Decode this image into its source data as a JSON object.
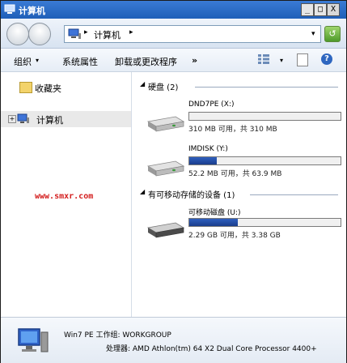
{
  "window": {
    "title": "计算机",
    "min_label": "_",
    "max_label": "□",
    "close_label": "X"
  },
  "nav": {
    "address_text": "计算机",
    "sep": "▸",
    "dropdown": "▾",
    "refresh": "↺"
  },
  "toolbar": {
    "organize": "组织",
    "organize_arrow": "▾",
    "system_properties": "系统属性",
    "uninstall": "卸载或更改程序",
    "more": "»",
    "view_arrow": "▾",
    "help": "?"
  },
  "navpane": {
    "favorites": "收藏夹",
    "computer": "计算机",
    "expand": "+",
    "watermark": "www.smxr.com"
  },
  "content": {
    "group_hdd": "硬盘 (2)",
    "group_removable": "有可移动存储的设备 (1)",
    "group_arrow": "◢",
    "drives": [
      {
        "name": "DND7PE (X:)",
        "detail": "310 MB 可用，共 310 MB",
        "usage": 0.0
      },
      {
        "name": "IMDISK (Y:)",
        "detail": "52.2 MB 可用，共 63.9 MB",
        "usage": 0.18
      },
      {
        "name": "可移动磁盘 (U:)",
        "detail": "2.29 GB 可用，共 3.38 GB",
        "usage": 0.32
      }
    ]
  },
  "details": {
    "line1": "Win7 PE  工作组: WORKGROUP",
    "line2": "处理器: AMD Athlon(tm) 64 X2 Dual Core Processor 4400+"
  },
  "colors": {
    "title_bar": "#2c6cc8",
    "drive_fill": "#1f46a0",
    "watermark": "#d31d1d"
  }
}
